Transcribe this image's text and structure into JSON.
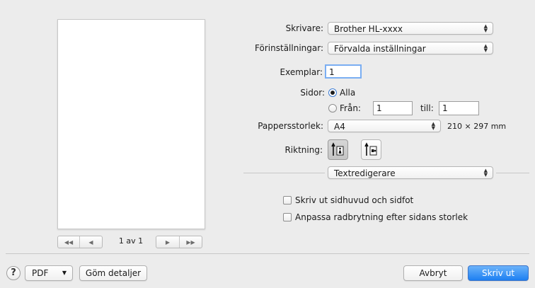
{
  "preview": {
    "page_indicator": "1 av 1"
  },
  "printer": {
    "label": "Skrivare:",
    "value": "Brother HL-xxxx"
  },
  "presets": {
    "label": "Förinställningar:",
    "value": "Förvalda inställningar"
  },
  "copies": {
    "label": "Exemplar:",
    "value": "1"
  },
  "pages": {
    "label": "Sidor:",
    "all_label": "Alla",
    "from_label": "Från:",
    "from_value": "1",
    "to_label": "till:",
    "to_value": "1",
    "selected": "all"
  },
  "paper": {
    "label": "Pappersstorlek:",
    "value": "A4",
    "dimensions": "210 × 297 mm"
  },
  "orientation": {
    "label": "Riktning:",
    "selected": "portrait"
  },
  "section": {
    "value": "Textredigerare"
  },
  "options": [
    {
      "label": "Skriv ut sidhuvud och sidfot",
      "checked": false
    },
    {
      "label": "Anpassa radbrytning efter sidans storlek",
      "checked": false
    }
  ],
  "footer": {
    "help": "?",
    "pdf_label": "PDF",
    "hide_details_label": "Göm detaljer",
    "cancel_label": "Avbryt",
    "print_label": "Skriv ut"
  },
  "colors": {
    "accent": "#1d7ff2",
    "background": "#ececec"
  },
  "icons": [
    "first-page-icon",
    "prev-page-icon",
    "next-page-icon",
    "last-page-icon",
    "popup-arrows-icon",
    "portrait-orientation-icon",
    "landscape-orientation-icon",
    "dropdown-arrow-icon",
    "help-icon"
  ]
}
